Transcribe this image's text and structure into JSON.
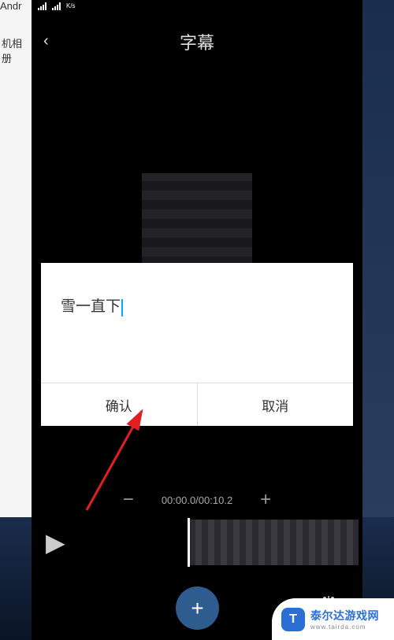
{
  "status": {
    "speed": "K/s"
  },
  "bgLeft": {
    "text1": "Andr",
    "text2": "机相册"
  },
  "title": "字幕",
  "dialog": {
    "inputText": "雪一直下",
    "confirm": "确认",
    "cancel": "取消"
  },
  "time": {
    "display": "00:00.0/00:10.2",
    "minus": "−",
    "plus": "+"
  },
  "play": "▶",
  "add": "+",
  "adjust": "⚙",
  "watermark": {
    "logo": "T",
    "main": "泰尔达游戏网",
    "sub": "www.tairda.com"
  }
}
